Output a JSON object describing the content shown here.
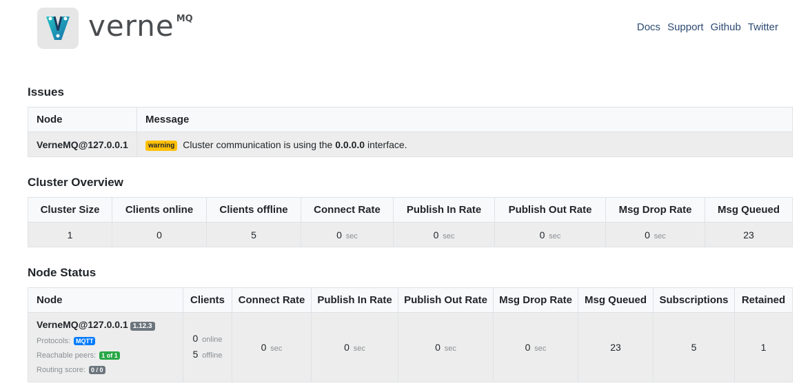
{
  "header": {
    "logo_text": "verne",
    "logo_sup": "MQ",
    "nav": [
      "Docs",
      "Support",
      "Github",
      "Twitter"
    ]
  },
  "issues": {
    "title": "Issues",
    "headers": [
      "Node",
      "Message"
    ],
    "row": {
      "node": "VerneMQ@127.0.0.1",
      "badge": "warning",
      "msg_before": "Cluster communication is using the",
      "msg_bold": "0.0.0.0",
      "msg_after": "interface."
    }
  },
  "cluster": {
    "title": "Cluster Overview",
    "headers": [
      "Cluster Size",
      "Clients online",
      "Clients offline",
      "Connect Rate",
      "Publish In Rate",
      "Publish Out Rate",
      "Msg Drop Rate",
      "Msg Queued"
    ],
    "values": {
      "cluster_size": "1",
      "clients_online": "0",
      "clients_offline": "5",
      "connect_rate": "0",
      "publish_in_rate": "0",
      "publish_out_rate": "0",
      "msg_drop_rate": "0",
      "msg_queued": "23"
    },
    "rate_unit": "sec"
  },
  "node_status": {
    "title": "Node Status",
    "headers": [
      "Node",
      "Clients",
      "Connect Rate",
      "Publish In Rate",
      "Publish Out Rate",
      "Msg Drop Rate",
      "Msg Queued",
      "Subscriptions",
      "Retained"
    ],
    "row": {
      "node": "VerneMQ@127.0.0.1",
      "version": "1.12.3",
      "protocols_label": "Protocols:",
      "protocols_badge": "MQTT",
      "peers_label": "Reachable peers:",
      "peers_badge": "1 of 1",
      "routing_label": "Routing score:",
      "routing_badge": "0 / 0",
      "clients_online": "0",
      "online_label": "online",
      "clients_offline": "5",
      "offline_label": "offline",
      "connect_rate": "0",
      "publish_in_rate": "0",
      "publish_out_rate": "0",
      "msg_drop_rate": "0",
      "msg_queued": "23",
      "subscriptions": "5",
      "retained": "1"
    },
    "rate_unit": "sec"
  },
  "colors": {
    "warning": "#ffc107",
    "link": "#2c4a72",
    "version_badge": "#6c757d",
    "protocol_badge": "#007bff",
    "peers_badge": "#28a745"
  }
}
